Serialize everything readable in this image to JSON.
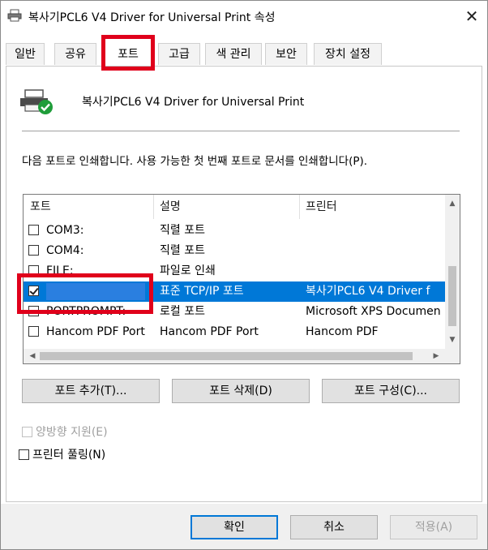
{
  "window": {
    "title": "복사기PCL6 V4 Driver for Universal Print 속성",
    "close_glyph": "✕"
  },
  "tabs": [
    {
      "label": "일반",
      "active": false
    },
    {
      "label": "공유",
      "active": false
    },
    {
      "label": "포트",
      "active": true
    },
    {
      "label": "고급",
      "active": false
    },
    {
      "label": "색 관리",
      "active": false
    },
    {
      "label": "보안",
      "active": false
    },
    {
      "label": "장치 설정",
      "active": false
    }
  ],
  "printer": {
    "name": "복사기PCL6 V4 Driver for Universal Print",
    "icon": "printer-ready-icon"
  },
  "description": "다음 포트로 인쇄합니다. 사용 가능한 첫 번째 포트로 문서를 인쇄합니다(P).",
  "port_list": {
    "columns": [
      "포트",
      "설명",
      "프린터"
    ],
    "rows": [
      {
        "port": "COM3:",
        "desc": "직렬 포트",
        "printer": "",
        "checked": false,
        "selected": false,
        "redacted": false
      },
      {
        "port": "COM4:",
        "desc": "직렬 포트",
        "printer": "",
        "checked": false,
        "selected": false,
        "redacted": false
      },
      {
        "port": "FILE:",
        "desc": "파일로 인쇄",
        "printer": "",
        "checked": false,
        "selected": false,
        "redacted": false
      },
      {
        "port": "",
        "desc": "표준 TCP/IP 포트",
        "printer": "복사기PCL6 V4 Driver f",
        "checked": true,
        "selected": true,
        "redacted": true
      },
      {
        "port": "PORTPROMPT:",
        "desc": "로컬 포트",
        "printer": "Microsoft XPS Documen",
        "checked": false,
        "selected": false,
        "redacted": false
      },
      {
        "port": "Hancom PDF Port",
        "desc": "Hancom PDF Port",
        "printer": "Hancom PDF",
        "checked": false,
        "selected": false,
        "redacted": false
      }
    ]
  },
  "port_buttons": {
    "add": "포트 추가(T)...",
    "delete": "포트 삭제(D)",
    "configure": "포트 구성(C)..."
  },
  "options": {
    "bidirectional": {
      "label": "양방향 지원(E)",
      "enabled": false,
      "checked": false
    },
    "pooling": {
      "label": "프린터 풀링(N)",
      "enabled": true,
      "checked": false
    }
  },
  "footer": {
    "ok": "확인",
    "cancel": "취소",
    "apply": "적용(A)"
  },
  "colors": {
    "selection": "#0078d7",
    "highlight_border": "#e0001b"
  }
}
